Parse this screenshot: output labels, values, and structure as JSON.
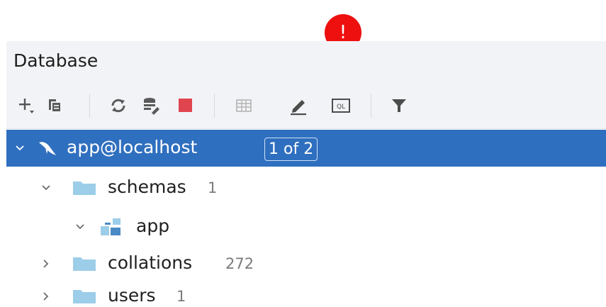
{
  "panel": {
    "title": "Database"
  },
  "alert": {
    "symbol": "!"
  },
  "toolbar": {
    "buttons": [
      {
        "name": "add-button",
        "icon": "plus-with-dropdown-icon"
      },
      {
        "name": "copy-button",
        "icon": "copy-icon"
      },
      {
        "name": "refresh-button",
        "icon": "refresh-icon"
      },
      {
        "name": "data-source-properties-button",
        "icon": "database-wrench-icon"
      },
      {
        "name": "stop-button",
        "icon": "stop-icon",
        "color": "#e0454f"
      },
      {
        "name": "table-view-button",
        "icon": "table-icon"
      },
      {
        "name": "edit-button",
        "icon": "pencil-icon"
      },
      {
        "name": "query-console-button",
        "icon": "ql-console-icon",
        "text": "QL"
      },
      {
        "name": "filter-button",
        "icon": "filter-icon"
      }
    ]
  },
  "tree": {
    "root": {
      "label": "app@localhost",
      "badge": "1 of 2",
      "expanded": true,
      "icon": "mysql-dolphin-icon"
    },
    "items": [
      {
        "label": "schemas",
        "count": "1",
        "expanded": true,
        "icon": "folder-icon"
      },
      {
        "label": "app",
        "expanded": true,
        "icon": "schema-icon"
      },
      {
        "label": "collations",
        "count": "272",
        "expanded": false,
        "icon": "folder-icon"
      },
      {
        "label": "users",
        "count": "1",
        "expanded": false,
        "icon": "folder-icon"
      }
    ]
  },
  "colors": {
    "selection": "#2f6fbf",
    "folder": "#9ccde9",
    "alert": "#ee0f0f"
  }
}
